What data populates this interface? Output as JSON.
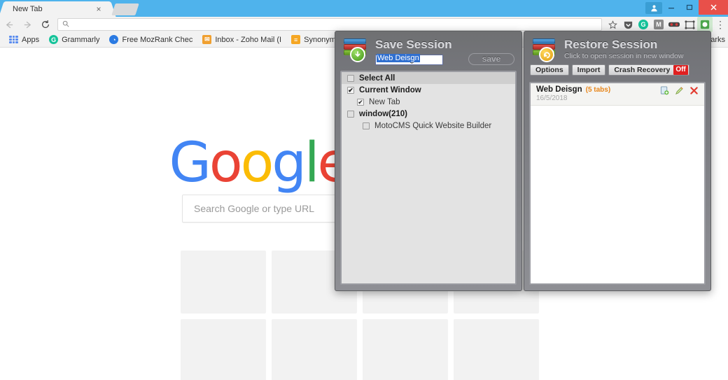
{
  "browser": {
    "tab": {
      "title": "New Tab",
      "close_label": "×"
    },
    "newtab_button_name": "new-tab-button",
    "window_controls": {
      "avatar": "●",
      "minimize": "–",
      "maximize": "❐",
      "close": "×"
    },
    "toolbar": {
      "back": "←",
      "forward": "→",
      "reload": "⟳",
      "omnibox": {
        "value": "",
        "placeholder": "",
        "search_icon": "⚲"
      },
      "star": "☆",
      "extensions": [
        {
          "name": "pocket-extension-icon",
          "glyph": "▼",
          "color": "#5a5a5a"
        },
        {
          "name": "grammarly-extension-icon",
          "glyph": "G",
          "color": "#15c39a"
        },
        {
          "name": "mail-extension-icon",
          "glyph": "M",
          "color": "#6e6e6e"
        },
        {
          "name": "glasses-extension-icon",
          "glyph": "▬",
          "color": "#d63b3b"
        },
        {
          "name": "frame-extension-icon",
          "glyph": "⬚",
          "color": "#4a4a4a"
        },
        {
          "name": "session-buddy-extension-icon",
          "glyph": "◐",
          "color": "#4ca64c"
        }
      ],
      "menu": "⋮"
    },
    "bookmarks": {
      "apps_label": "Apps",
      "items": [
        {
          "label": "Grammarly",
          "icon_glyph": "G",
          "icon_color": "#15c39a"
        },
        {
          "label": "Free MozRank Chec",
          "icon_glyph": "◔",
          "icon_color": "#2a7ae2"
        },
        {
          "label": "Inbox - Zoho Mail (I",
          "icon_glyph": "✉",
          "icon_color": "#f0a030"
        },
        {
          "label": "Synonym Synonyms",
          "icon_glyph": "≡",
          "icon_color": "#f5a623"
        }
      ],
      "overflow_label": "arks"
    }
  },
  "page": {
    "logo_letters": [
      "G",
      "o",
      "o",
      "g",
      "l",
      "e"
    ],
    "search_placeholder": "Search Google or type URL",
    "tiles_count": 8
  },
  "save_panel": {
    "title": "Save Session",
    "session_name_value": "Web Deisgn",
    "save_button_label": "save",
    "tree": [
      {
        "label": "Select All",
        "checked": false,
        "level": 0,
        "header": true,
        "bold": true
      },
      {
        "label": "Current Window",
        "checked": true,
        "level": 0,
        "header": false,
        "bold": true
      },
      {
        "label": "New Tab",
        "checked": true,
        "level": 1,
        "header": false,
        "bold": false
      },
      {
        "label": "window(210)",
        "checked": false,
        "level": 0,
        "header": false,
        "bold": true
      },
      {
        "label": "MotoCMS Quick Website Builder",
        "checked": false,
        "level": 2,
        "header": false,
        "bold": false
      }
    ],
    "check_glyph": "✔"
  },
  "restore_panel": {
    "title": "Restore Session",
    "subtitle": "Click to open session in new window",
    "buttons": [
      {
        "label": "Options"
      },
      {
        "label": "Import"
      },
      {
        "label": "Crash Recovery",
        "badge": "Off",
        "badge_color": "#e02020"
      }
    ],
    "sessions": [
      {
        "name": "Web Deisgn",
        "tab_count": "(5 tabs)",
        "date": "16/5/2018",
        "actions": [
          {
            "name": "open-in-new-icon",
            "glyph": "⧉"
          },
          {
            "name": "edit-pencil-icon",
            "glyph": "✎"
          },
          {
            "name": "delete-icon",
            "glyph": "✖"
          }
        ]
      }
    ]
  }
}
